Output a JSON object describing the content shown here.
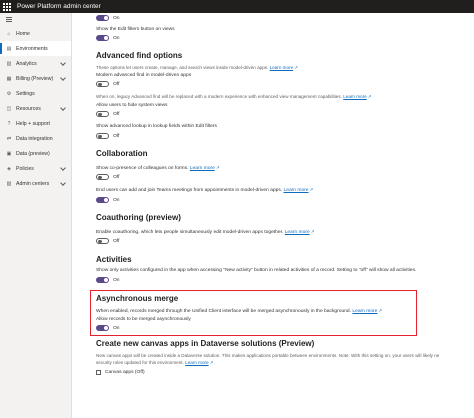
{
  "header": {
    "title": "Power Platform admin center"
  },
  "sidebar": {
    "items": [
      {
        "label": "Home",
        "icon": "home-icon",
        "glyph": "⌂",
        "chevron": false,
        "active": false
      },
      {
        "label": "Environments",
        "icon": "environments-icon",
        "glyph": "▤",
        "chevron": false,
        "active": true
      },
      {
        "label": "Analytics",
        "icon": "analytics-icon",
        "glyph": "▥",
        "chevron": true,
        "active": false
      },
      {
        "label": "Billing (Preview)",
        "icon": "billing-icon",
        "glyph": "▦",
        "chevron": true,
        "active": false
      },
      {
        "label": "Settings",
        "icon": "gear-icon",
        "glyph": "⚙",
        "chevron": false,
        "active": false
      },
      {
        "label": "Resources",
        "icon": "resources-icon",
        "glyph": "◫",
        "chevron": true,
        "active": false
      },
      {
        "label": "Help + support",
        "icon": "help-icon",
        "glyph": "?",
        "chevron": false,
        "active": false
      },
      {
        "label": "Data integration",
        "icon": "data-integration-icon",
        "glyph": "⇄",
        "chevron": false,
        "active": false
      },
      {
        "label": "Data (preview)",
        "icon": "data-icon",
        "glyph": "▣",
        "chevron": false,
        "active": false
      },
      {
        "label": "Policies",
        "icon": "policies-icon",
        "glyph": "◈",
        "chevron": true,
        "active": false
      },
      {
        "label": "Admin centers",
        "icon": "admin-centers-icon",
        "glyph": "▧",
        "chevron": true,
        "active": false
      }
    ]
  },
  "main": {
    "top_toggle": "On",
    "show_edit_filters": {
      "label": "Show the Edit filters button on views",
      "state": "On"
    },
    "advanced_find": {
      "heading": "Advanced find options",
      "desc": "These options let users create, manage, and search views inside model-driven apps.",
      "learn_more": "Learn more",
      "modern_label": "Modern advanced find in model-driven apps",
      "modern_state": "Off",
      "modern_desc": "When on, legacy Advanced find will be replaced with a modern experience with enhanced view management capabilities.",
      "hide_label": "Allow users to hide system views",
      "hide_state": "Off",
      "lookup_label": "Show advanced lookup in lookup fields within Edit filters",
      "lookup_state": "Off"
    },
    "collaboration": {
      "heading": "Collaboration",
      "presence_label": "Show co-presence of colleagues on forms.",
      "presence_state": "Off",
      "teams_label": "End users can add and join Teams meetings from appointments in model-driven apps.",
      "teams_state": "On",
      "learn_more": "Learn more"
    },
    "coauthoring": {
      "heading": "Coauthoring (preview)",
      "desc": "Enable coauthoring, which lets people simultaneously edit model-driven apps together.",
      "learn_more": "Learn more",
      "state": "Off"
    },
    "activities": {
      "heading": "Activities",
      "desc": "Show only activities configured in the app when accessing \"New activity\" button in related activities of a record. Setting to \"off\" will show all activities.",
      "state": "On"
    },
    "async_merge": {
      "heading": "Asynchronous merge",
      "desc": "When enabled, records merged through the Unified Client interface will be merged asynchronously in the background.",
      "learn_more": "Learn more",
      "allow_label": "Allow records to be merged asynchronously",
      "state": "On"
    },
    "canvas_apps": {
      "heading": "Create new canvas apps in Dataverse solutions (Preview)",
      "desc1": "New canvas apps will be created inside a Dataverse solution. This makes applications portable between environments. Note: With this setting on, your users will likely ne",
      "desc2": "security roles updated for this environment.",
      "learn_more": "Learn more",
      "checkbox_label": "Canvas apps (Off)"
    }
  },
  "colors": {
    "accent": "#5b4a8b",
    "link": "#0f6cbd",
    "highlight": "#e2222f",
    "topbar": "#201f1e"
  }
}
